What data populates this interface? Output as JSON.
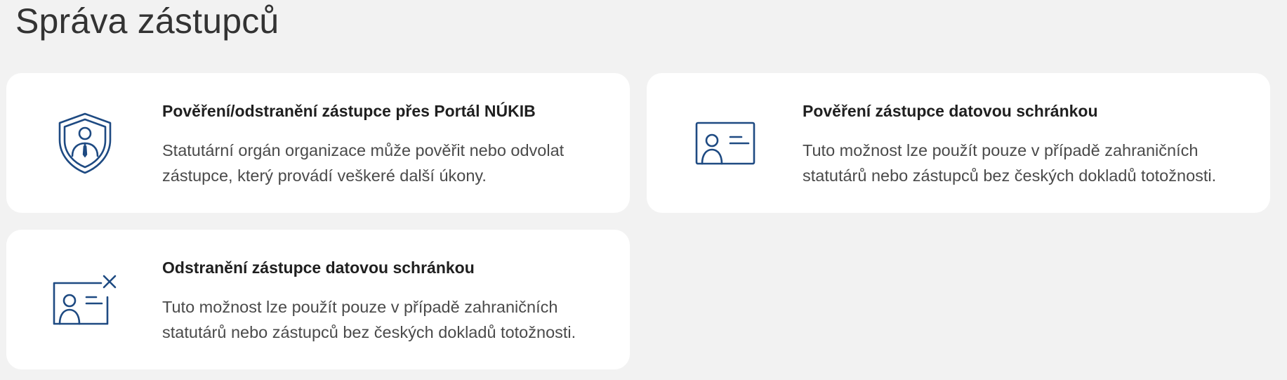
{
  "page": {
    "title": "Správa zástupců"
  },
  "colors": {
    "background": "#f2f2f2",
    "card": "#ffffff",
    "icon_stroke": "#1e4a82",
    "title_text": "#1f1f1f",
    "body_text": "#4a4a4a"
  },
  "cards": [
    {
      "icon": "shield-person-icon",
      "title": "Pověření/odstranění zástupce přes Portál NÚKIB",
      "description": "Statutární orgán organizace může pověřit nebo odvolat zástupce, který provádí veškeré další úkony."
    },
    {
      "icon": "id-card-icon",
      "title": "Pověření zástupce datovou schránkou",
      "description": "Tuto možnost lze použít pouze v případě zahraničních statutárů nebo zástupců bez českých dokladů totožnosti."
    },
    {
      "icon": "id-card-remove-icon",
      "title": "Odstranění zástupce datovou schránkou",
      "description": "Tuto možnost lze použít pouze v případě zahraničních statutárů nebo zástupců bez českých dokladů totožnosti."
    }
  ]
}
